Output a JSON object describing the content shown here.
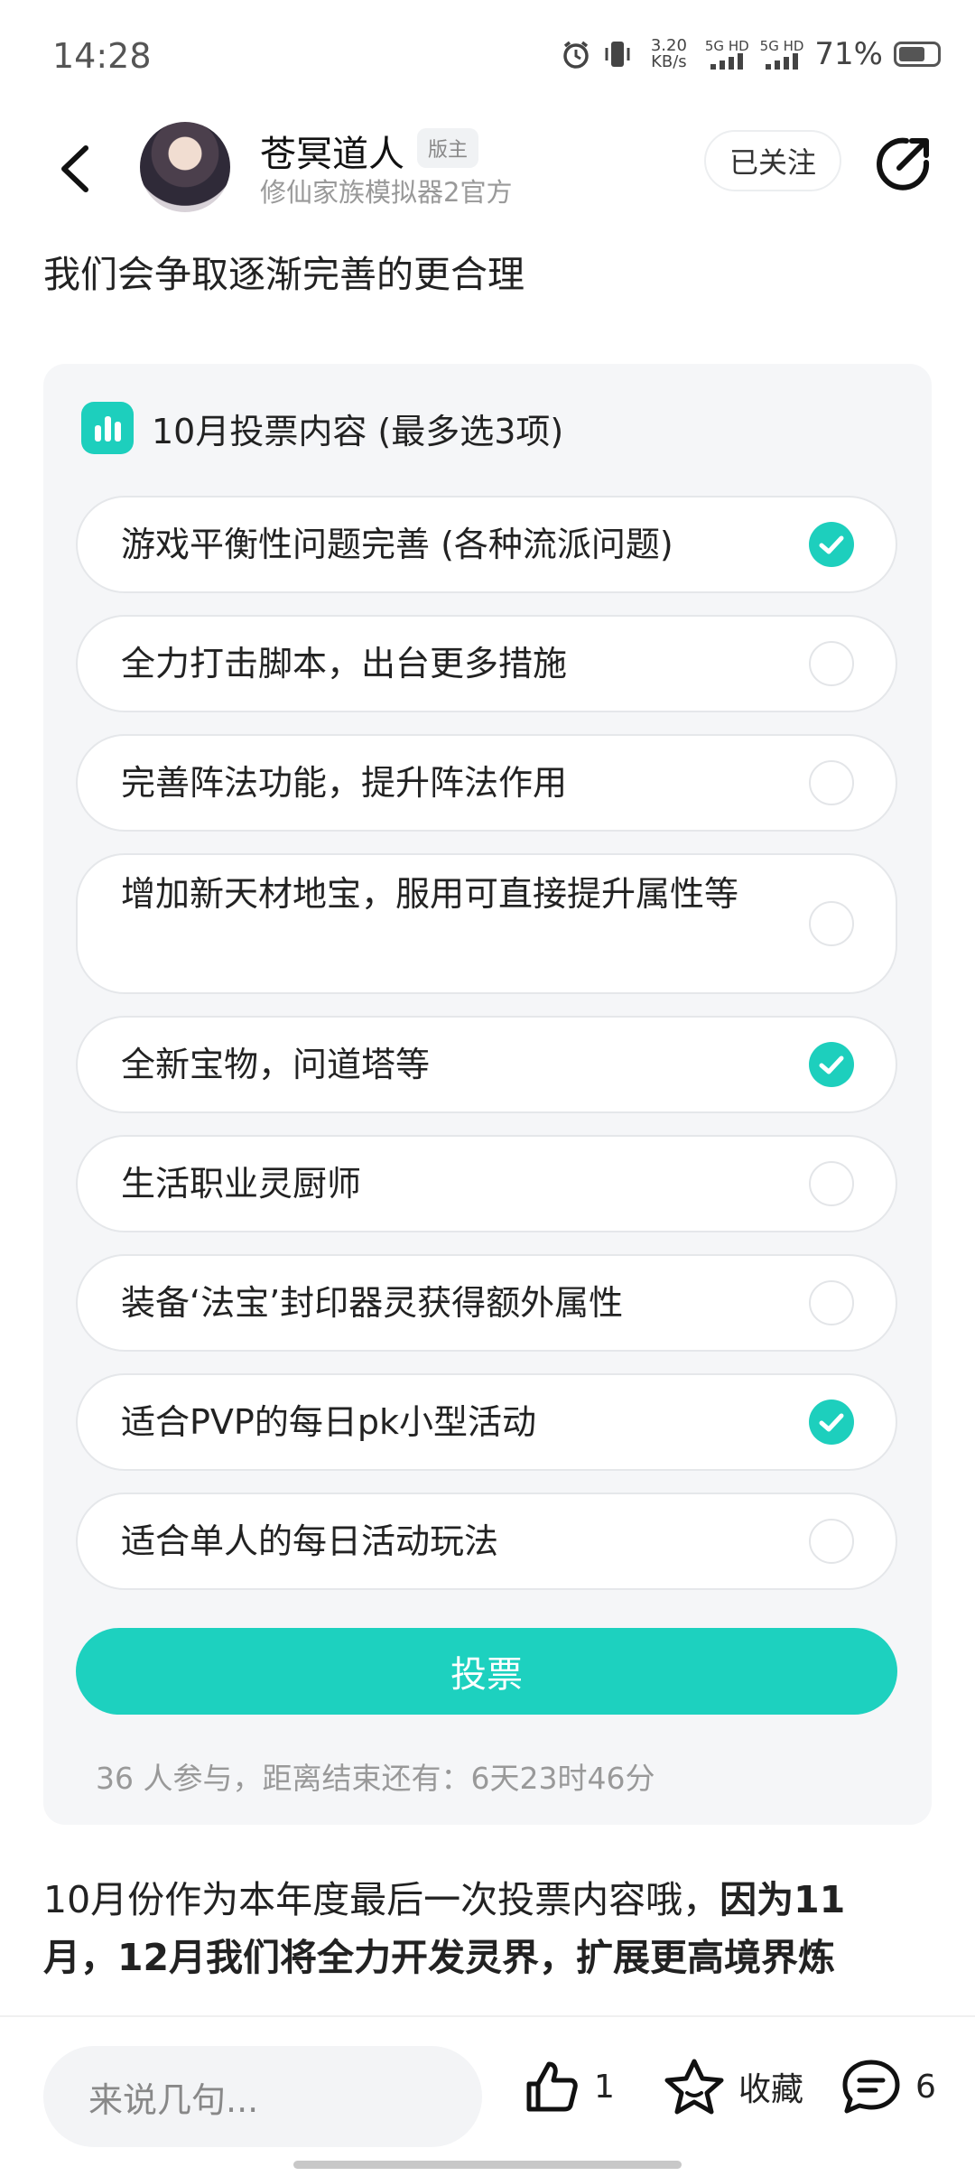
{
  "status_bar": {
    "time": "14:28",
    "speed_top": "3.20",
    "speed_unit": "KB/s",
    "net1": "5G HD",
    "net2": "5G HD",
    "battery": "71%",
    "battery_level": 0.71
  },
  "header": {
    "author_name": "苍冥道人",
    "author_badge": "版主",
    "author_sub": "修仙家族模拟器2官方",
    "follow_label": "已关注"
  },
  "lead_text": "我们会争取逐渐完善的更合理",
  "poll": {
    "title": "10月投票内容 (最多选3项)",
    "options": [
      {
        "label": "游戏平衡性问题完善 (各种流派问题)",
        "checked": true
      },
      {
        "label": "全力打击脚本，出台更多措施",
        "checked": false
      },
      {
        "label": "完善阵法功能，提升阵法作用",
        "checked": false
      },
      {
        "label": "增加新天材地宝，服用可直接提升属性等",
        "checked": false
      },
      {
        "label": "全新宝物，问道塔等",
        "checked": true
      },
      {
        "label": "生活职业灵厨师",
        "checked": false
      },
      {
        "label": "装备‘法宝’封印器灵获得额外属性",
        "checked": false
      },
      {
        "label": "适合PVP的每日pk小型活动",
        "checked": true
      },
      {
        "label": "适合单人的每日活动玩法",
        "checked": false
      }
    ],
    "vote_label": "投票",
    "participants": "36 人参与，距离结束还有：6天23时46分"
  },
  "body": {
    "line1_normal": "10月份作为本年度最后一次投票内容哦，",
    "line1_bold": "因为11",
    "line2_bold": "月，12月我们将全力开发灵界，扩展更高境界炼"
  },
  "bottom_bar": {
    "comment_placeholder": "来说几句...",
    "like_count": "1",
    "favorite_label": "收藏",
    "comment_count": "6"
  },
  "colors": {
    "accent": "#1dcfbd",
    "card_bg": "#f5f6f8"
  }
}
